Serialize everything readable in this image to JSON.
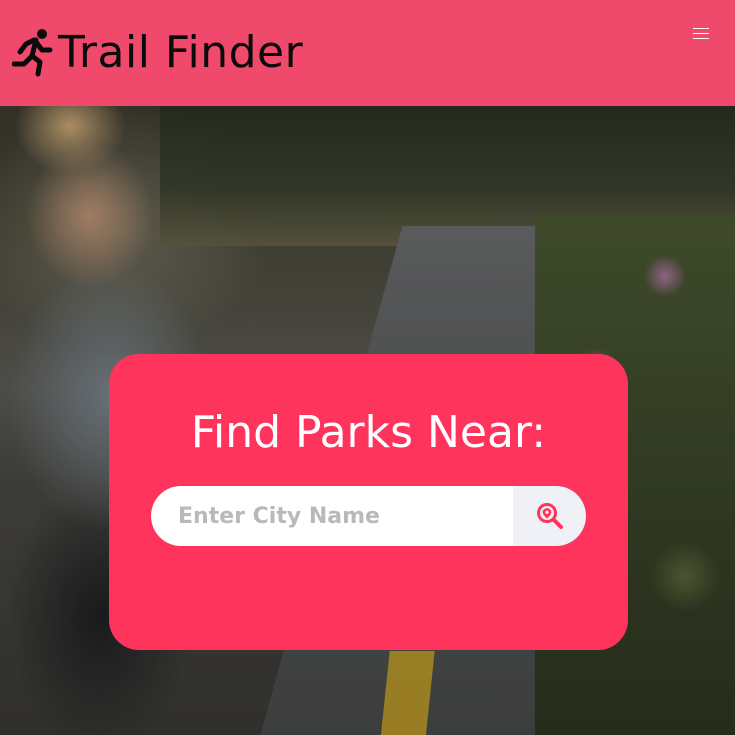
{
  "header": {
    "brand_name": "Trail Finder",
    "brand_icon": "running-person-icon",
    "menu_icon": "hamburger-menu-icon"
  },
  "hero": {
    "image": "woman-running-on-road-photo"
  },
  "search_card": {
    "title": "Find Parks Near:",
    "input_value": "",
    "input_placeholder": "Enter City Name",
    "button_icon": "location-search-icon"
  },
  "colors": {
    "navbar_bg": "#ef4a6b",
    "card_bg": "#ff345c",
    "button_bg": "#eff1f6",
    "icon_accent": "#ff345c"
  }
}
